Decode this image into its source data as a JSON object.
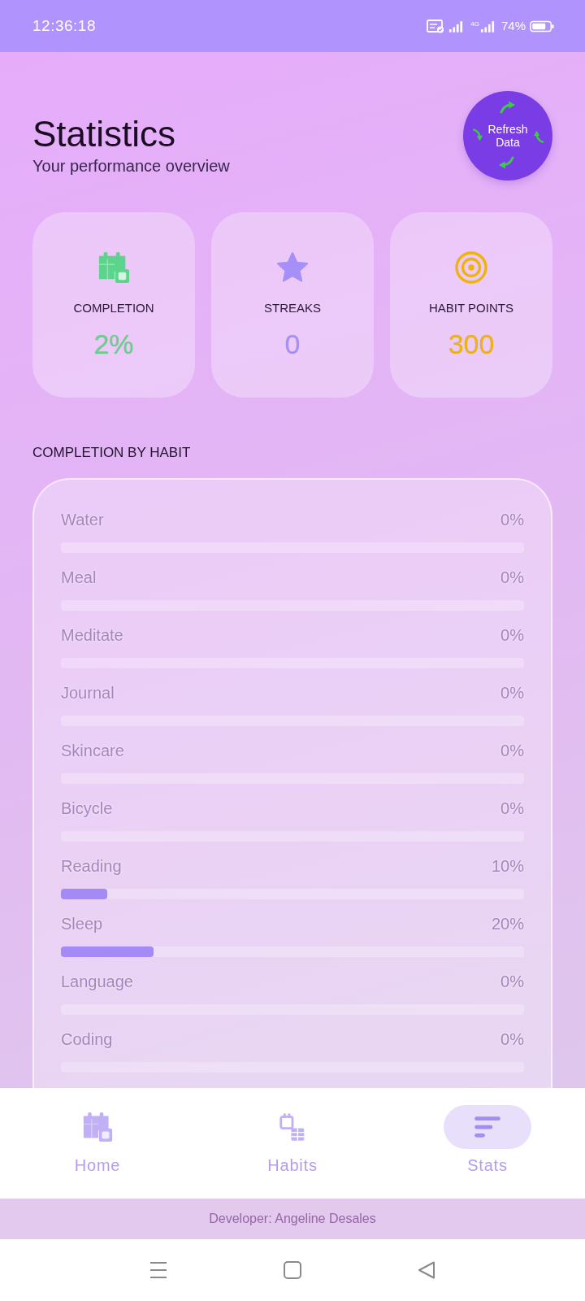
{
  "status_bar": {
    "time": "12:36:18",
    "network": "4G",
    "battery": "74%"
  },
  "header": {
    "title": "Statistics",
    "subtitle": "Your performance overview",
    "refresh_button": "Refresh Data"
  },
  "stats": [
    {
      "label": "COMPLETION",
      "value": "2%",
      "color": "#5dd48c"
    },
    {
      "label": "STREAKS",
      "value": "0",
      "color": "#a590f7"
    },
    {
      "label": "HABIT POINTS",
      "value": "300",
      "color": "#eeb40c"
    }
  ],
  "completion_by_habit": {
    "title": "COMPLETION BY HABIT",
    "habits": [
      {
        "name": "Water",
        "percent": "0%",
        "level": 0
      },
      {
        "name": "Meal",
        "percent": "0%",
        "level": 0
      },
      {
        "name": "Meditate",
        "percent": "0%",
        "level": 0
      },
      {
        "name": "Journal",
        "percent": "0%",
        "level": 0
      },
      {
        "name": "Skincare",
        "percent": "0%",
        "level": 0
      },
      {
        "name": "Bicycle",
        "percent": "0%",
        "level": 0
      },
      {
        "name": "Reading",
        "percent": "10%",
        "level": 0.1
      },
      {
        "name": "Sleep",
        "percent": "20%",
        "level": 0.2
      },
      {
        "name": "Language",
        "percent": "0%",
        "level": 0
      },
      {
        "name": "Coding",
        "percent": "0%",
        "level": 0
      }
    ]
  },
  "bottom_nav": {
    "items": [
      {
        "label": "Home",
        "selected": false
      },
      {
        "label": "Habits",
        "selected": false
      },
      {
        "label": "Stats",
        "selected": true
      }
    ]
  },
  "footer": {
    "text": "Developer: Angeline Desales"
  }
}
